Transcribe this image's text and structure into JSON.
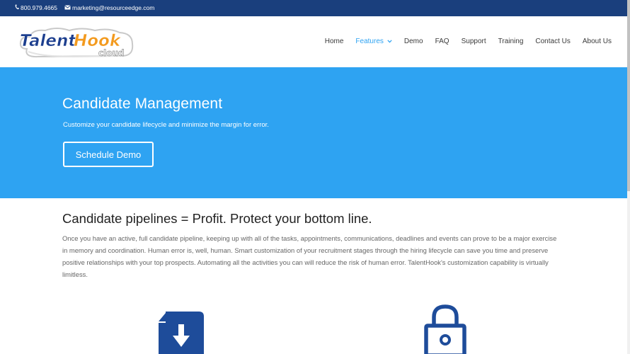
{
  "topbar": {
    "phone": "800.979.4665",
    "email": "marketing@resourceedge.com"
  },
  "logo": {
    "word1": "Talent",
    "word2": "Hook",
    "word3": "cloud"
  },
  "nav": {
    "items": [
      {
        "label": "Home"
      },
      {
        "label": "Features"
      },
      {
        "label": "Demo"
      },
      {
        "label": "FAQ"
      },
      {
        "label": "Support"
      },
      {
        "label": "Training"
      },
      {
        "label": "Contact Us"
      },
      {
        "label": "About Us"
      }
    ]
  },
  "hero": {
    "title": "Candidate Management",
    "subtitle": "Customize your candidate lifecycle and minimize the margin for error.",
    "button": "Schedule Demo"
  },
  "content": {
    "title": "Candidate pipelines = Profit. Protect your bottom line.",
    "body": "Once you have an active, full candidate pipeline, keeping up with all of the tasks, appointments, communications, deadlines and events can prove to be a major exercise in memory and coordination. Human error is, well, human. Smart customization of your recruitment stages through the hiring lifecycle can save you time and preserve positive relationships with your top prospects. Automating all the activities you can will reduce the risk of human error. TalentHook's customization capability is virtually limitless."
  },
  "colors": {
    "topbar": "#1a3f7d",
    "accent": "#2ea3f2",
    "icon": "#1e4c9a",
    "logo_blue": "#1c3e8e",
    "logo_orange": "#f39a1e"
  },
  "icons": {
    "phone": "phone-icon",
    "email": "envelope-icon",
    "features_chevron": "chevron-down-icon",
    "feature1": "download-icon",
    "feature2": "lock-icon"
  }
}
